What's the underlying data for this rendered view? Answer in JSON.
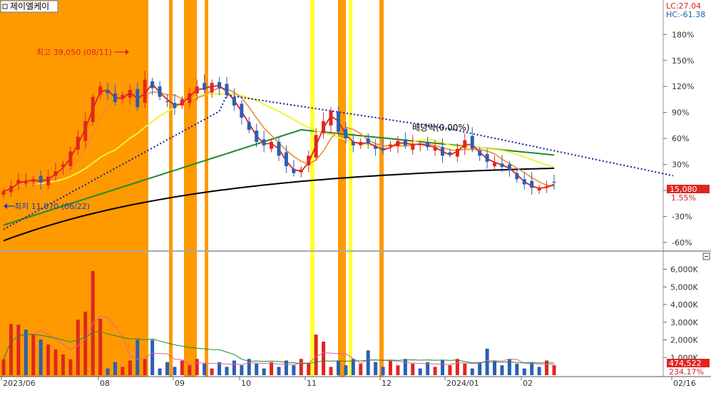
{
  "title": {
    "label": "제이엘케이",
    "icon": "square-icon"
  },
  "top_right": {
    "lc": "LC:27.04",
    "hc": "HC:-61.38"
  },
  "colors": {
    "orange_band": "#ff9900",
    "yellow_band": "#ffff33",
    "up": "#e0271f",
    "down": "#2b5fb4",
    "ma5": "#e62020",
    "ma20": "#f08a30",
    "ma60": "#f2f238",
    "ma120": "#1e8a2c",
    "ma240": "#000000",
    "dotted": "#1a1aa0",
    "price_badge": "#e0271f"
  },
  "annotations": {
    "high": "최고 39,050 (08/11)",
    "low": "최저 11,870 (06/22)",
    "dividend": "배당락(0.00%)"
  },
  "price_badge": {
    "value": "15,080",
    "pct": "1.55%"
  },
  "volume_badge": {
    "value": "474,522",
    "pct": "234.17%"
  },
  "chart_data": [
    {
      "type": "candlestick",
      "x_ticks": [
        "2023/06",
        "08",
        "09",
        "10",
        "11",
        "12",
        "2024/01",
        "02",
        "02/16"
      ],
      "y_ticks": [
        "180%",
        "150%",
        "120%",
        "90%",
        "60%",
        "30%",
        "0%",
        "-30%",
        "-60%"
      ],
      "ylim": [
        -70,
        200
      ],
      "series": [
        {
          "name": "close_pct",
          "values": [
            -1,
            5,
            12,
            10,
            13,
            9,
            16,
            22,
            30,
            45,
            62,
            80,
            108,
            120,
            112,
            102,
            110,
            116,
            96,
            128,
            118,
            108,
            102,
            95,
            105,
            112,
            120,
            116,
            124,
            118,
            110,
            98,
            84,
            70,
            56,
            52,
            56,
            40,
            28,
            20,
            24,
            40,
            64,
            80,
            92,
            68,
            60,
            52,
            56,
            54,
            48,
            46,
            53,
            57,
            52,
            54,
            53,
            50,
            50,
            40,
            42,
            48,
            58,
            48,
            40,
            33,
            32,
            27,
            24,
            13,
            7,
            3,
            2,
            5,
            9
          ]
        }
      ]
    },
    {
      "type": "bar",
      "y_ticks": [
        "6,000K",
        "5,000K",
        "4,000K",
        "3,000K",
        "2,000K",
        "1,000K"
      ],
      "ylim": [
        0,
        6600
      ]
    }
  ]
}
